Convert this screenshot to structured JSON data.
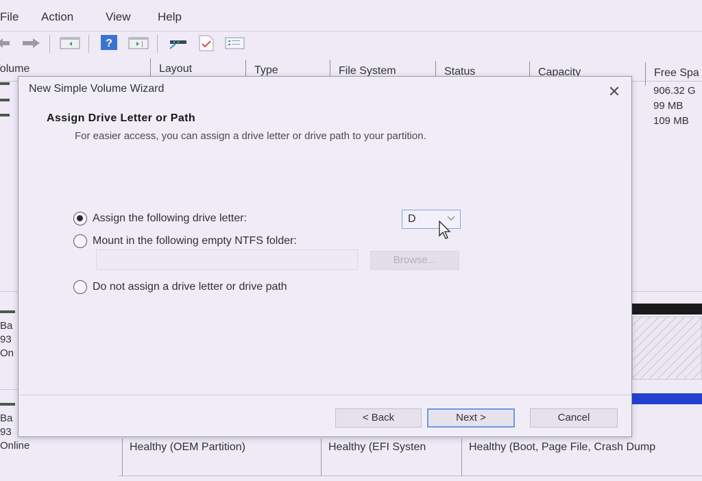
{
  "menu": [
    "File",
    "Action",
    "View",
    "Help"
  ],
  "toolbar_icons": [
    "back-icon",
    "forward-icon",
    "show-hide-console-tree-icon",
    "help-icon",
    "show-hide-action-pane-icon",
    "connect-icon",
    "check-icon",
    "properties-icon"
  ],
  "volume_list": {
    "columns": [
      "Volume",
      "Layout",
      "Type",
      "File System",
      "Status",
      "Capacity",
      "Free Spa"
    ],
    "free_space": [
      "906.32 G",
      "99 MB",
      "109 MB"
    ]
  },
  "disks": [
    {
      "label_lines": [
        "Ba",
        "93",
        "On"
      ]
    },
    {
      "label_lines": [
        "Ba",
        "93",
        "Online"
      ]
    }
  ],
  "partition_status": [
    "Healthy (OEM Partition)",
    "Healthy (EFI Systen",
    "Healthy (Boot, Page File, Crash Dump"
  ],
  "colors": {
    "unallocated_bar": "#1a1a1c",
    "primary_bar": "#2340d0",
    "accent_border": "#6a9bdc"
  },
  "dialog": {
    "title": "New Simple Volume Wizard",
    "close_label": "✕",
    "header_title": "Assign Drive Letter or Path",
    "header_subtitle": "For easier access, you can assign a drive letter or drive path to your partition.",
    "options": {
      "assign_letter": {
        "label": "Assign the following drive letter:",
        "selected": true
      },
      "mount_folder": {
        "label": "Mount in the following empty NTFS folder:",
        "selected": false
      },
      "no_assign": {
        "label": "Do not assign a drive letter or drive path",
        "selected": false
      }
    },
    "drive_letter": "D",
    "folder_path": "",
    "browse_label": "Browse...",
    "back_label": "< Back",
    "next_label": "Next >",
    "cancel_label": "Cancel"
  }
}
